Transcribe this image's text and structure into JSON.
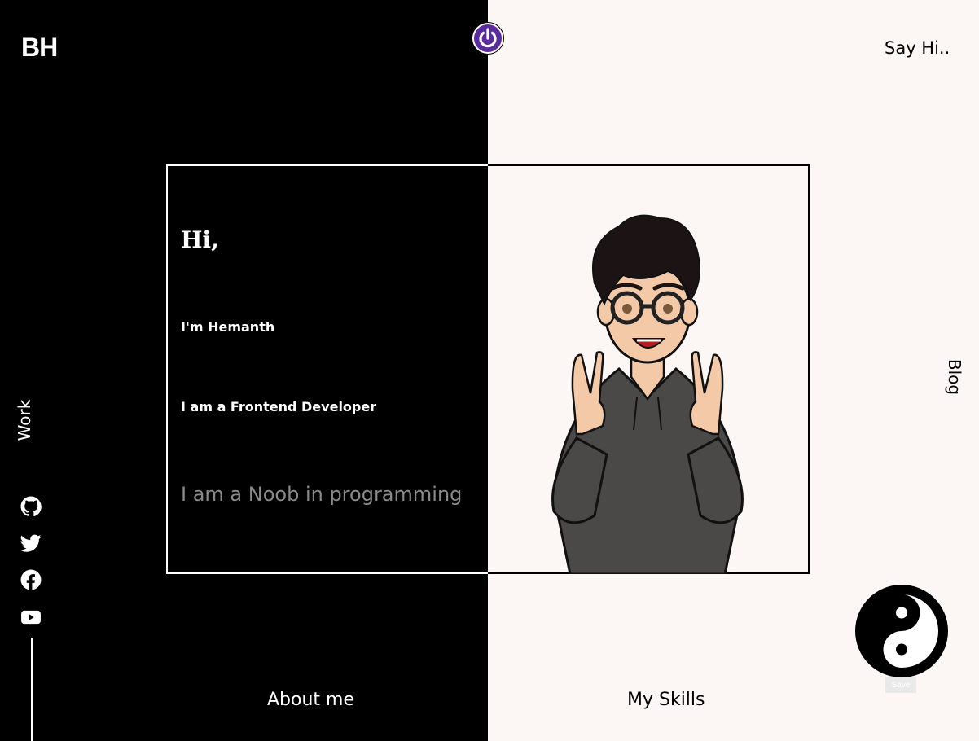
{
  "brand": {
    "logo_text": "BH"
  },
  "header": {
    "say_hi_label": "Say Hi.."
  },
  "nav": {
    "work_label": "Work",
    "blog_label": "Blog",
    "about_label": "About me",
    "skills_label": "My Skills"
  },
  "intro": {
    "greeting": "Hi,",
    "name_line": "I'm Hemanth",
    "role_line": "I am a Frontend Developer",
    "tagline": "I am a Noob in programming"
  },
  "social_icons": [
    "github-icon",
    "twitter-icon",
    "facebook-icon",
    "youtube-icon"
  ],
  "save_badge": "Save",
  "colors": {
    "dark": "#000000",
    "light": "#fcf6f4",
    "accent": "#5b2a9e",
    "muted_text": "#8a8a8a"
  }
}
